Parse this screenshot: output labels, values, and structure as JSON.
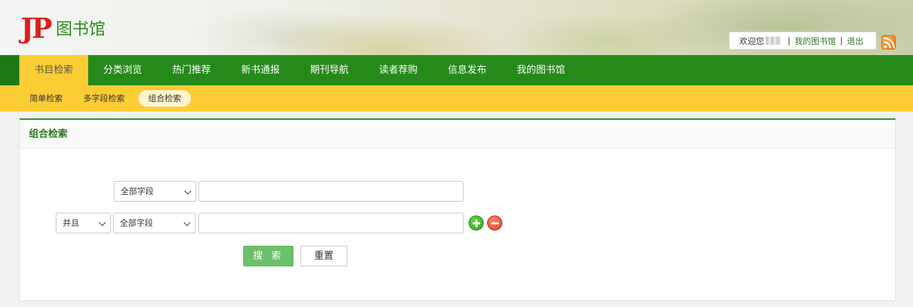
{
  "header": {
    "logo_mark": "JP",
    "logo_text": "图书馆",
    "welcome": "欢迎您",
    "my_library_link": "我的图书馆",
    "logout_link": "退出",
    "separator": "|"
  },
  "main_nav": [
    {
      "label": "书目检索",
      "active": true
    },
    {
      "label": "分类浏览",
      "active": false
    },
    {
      "label": "热门推荐",
      "active": false
    },
    {
      "label": "新书通报",
      "active": false
    },
    {
      "label": "期刊导航",
      "active": false
    },
    {
      "label": "读者荐购",
      "active": false
    },
    {
      "label": "信息发布",
      "active": false
    },
    {
      "label": "我的图书馆",
      "active": false
    }
  ],
  "sub_nav": [
    {
      "label": "简单检索",
      "active": false
    },
    {
      "label": "多字段检索",
      "active": false
    },
    {
      "label": "组合检索",
      "active": true
    }
  ],
  "panel": {
    "title": "组合检索",
    "row1": {
      "field_select": "全部字段",
      "query": ""
    },
    "row2": {
      "logic_select": "并且",
      "field_select": "全部字段",
      "query": ""
    },
    "search_button": "搜 索",
    "reset_button": "重置"
  },
  "colors": {
    "nav_green": "#268a1a",
    "accent_yellow": "#fccc34",
    "logo_red": "#d8231b",
    "search_green": "#6cc06b"
  },
  "icons": [
    "rss-icon",
    "add-row-icon",
    "remove-row-icon",
    "chevron-down-icon"
  ]
}
